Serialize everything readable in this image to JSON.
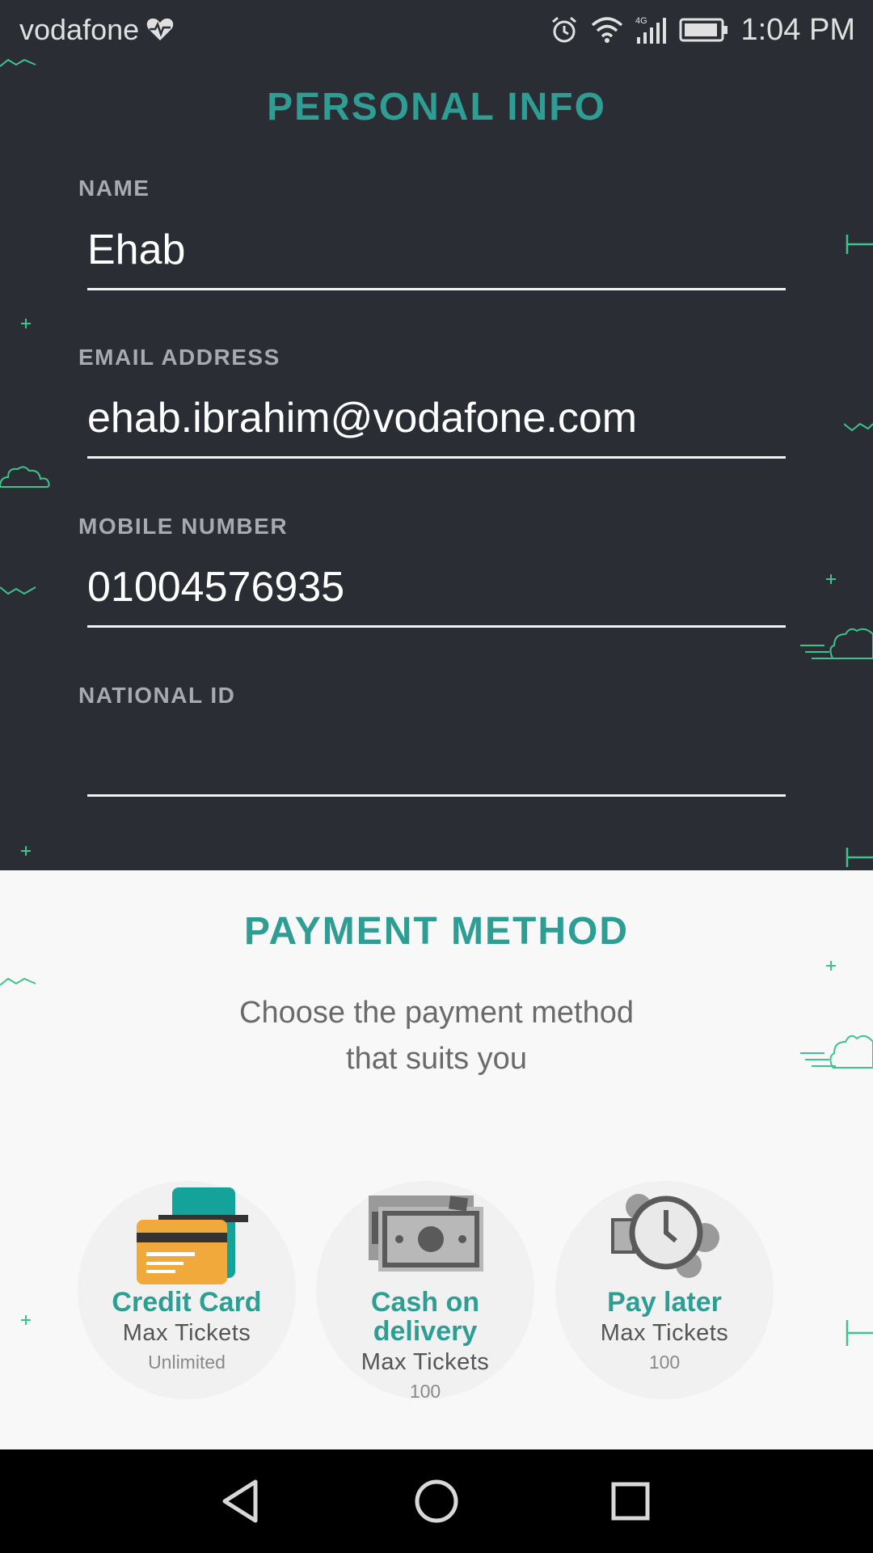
{
  "status_bar": {
    "carrier": "vodafone",
    "time": "1:04 PM",
    "network": "4G",
    "icons": [
      "heart-pulse-icon",
      "alarm-icon",
      "wifi-icon",
      "signal-icon",
      "battery-icon"
    ]
  },
  "personal_info": {
    "title": "PERSONAL INFO",
    "fields": [
      {
        "label": "NAME",
        "value": "Ehab"
      },
      {
        "label": "EMAIL ADDRESS",
        "value": "ehab.ibrahim@vodafone.com"
      },
      {
        "label": "MOBILE NUMBER",
        "value": "01004576935"
      },
      {
        "label": "NATIONAL ID",
        "value": ""
      }
    ]
  },
  "payment": {
    "title": "PAYMENT METHOD",
    "subtitle_line1": "Choose the payment method",
    "subtitle_line2": "that suits you",
    "methods": [
      {
        "name": "Credit Card",
        "max_label": "Max Tickets",
        "max_value": "Unlimited",
        "icon": "credit-card-icon"
      },
      {
        "name_line1": "Cash on",
        "name_line2": "delivery",
        "max_label": "Max Tickets",
        "max_value": "100",
        "icon": "cash-icon"
      },
      {
        "name": "Pay later",
        "max_label": "Max Tickets",
        "max_value": "100",
        "icon": "clock-coins-icon"
      }
    ]
  },
  "colors": {
    "dark_bg": "#2a2d33",
    "accent": "#2e9e94",
    "light_bg": "#f8f8f8",
    "deco_green": "#3cc48c"
  },
  "nav_bar": {
    "icons": [
      "back-triangle-icon",
      "home-circle-icon",
      "recents-square-icon"
    ]
  }
}
